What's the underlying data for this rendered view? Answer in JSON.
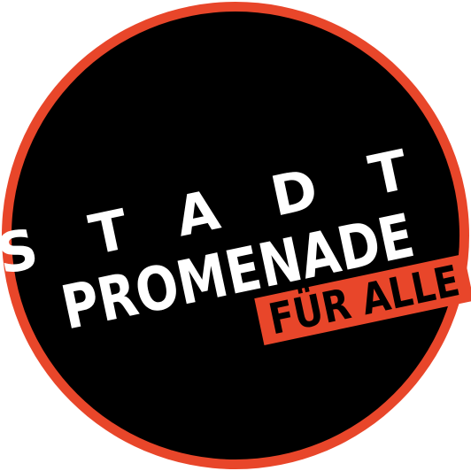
{
  "logo": {
    "word_top": "STADT",
    "word_main": "PROMENADE",
    "ribbon_text": "FÜR ALLE",
    "colors": {
      "ring": "#e8462a",
      "disc": "#000000",
      "text": "#ffffff",
      "ribbon": "#e8462a",
      "ribbon_text": "#000000",
      "background": "#ffffff"
    }
  }
}
